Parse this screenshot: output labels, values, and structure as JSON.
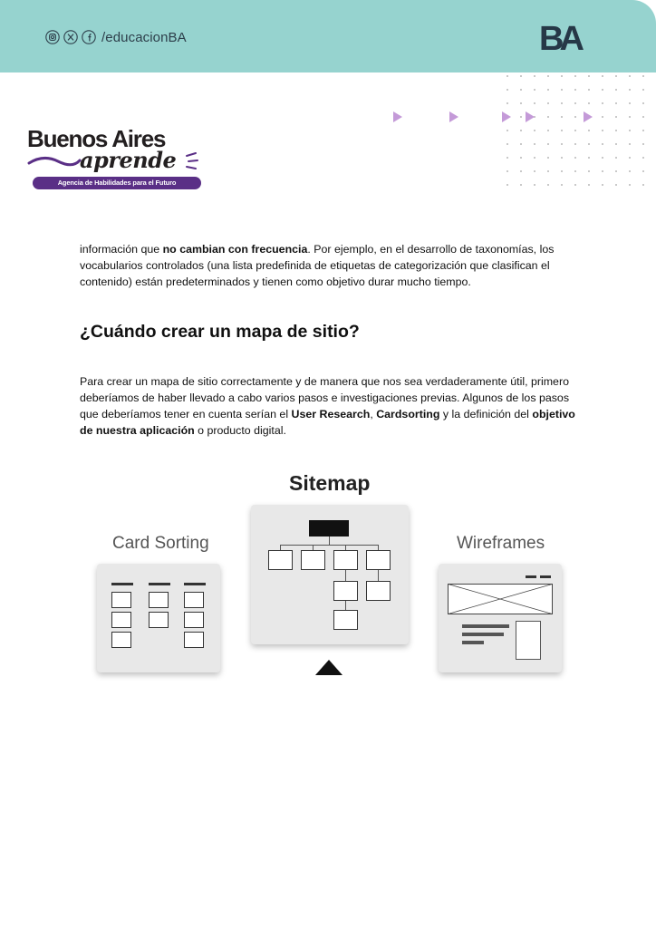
{
  "header": {
    "social_icons": [
      "instagram-icon",
      "x-icon",
      "facebook-icon"
    ],
    "handle": "/educacionBA",
    "logo_text": "BA",
    "background_color": "#96d3cf"
  },
  "brand": {
    "title": "Buenos Aires",
    "script": "aprende",
    "tagline": "Agencia de Habilidades para el Futuro",
    "accent_color": "#5a2f86"
  },
  "content": {
    "paragraph1": [
      {
        "text": "información que ",
        "bold": false
      },
      {
        "text": "no cambian con frecuencia",
        "bold": true
      },
      {
        "text": ". Por ejemplo, en el desarrollo de taxonomías, los vocabularios controlados (una lista predefinida de etiquetas de categorización que clasifican el contenido) están predeterminados y tienen como objetivo durar mucho tiempo.",
        "bold": false
      }
    ],
    "heading": "¿Cuándo crear un mapa de sitio?",
    "paragraph2": [
      {
        "text": "Para crear un mapa de sitio correctamente y de manera que nos sea verdaderamente útil, primero deberíamos de haber llevado a cabo varios pasos e investigaciones previas. Algunos de los pasos que deberíamos tener en cuenta serían el ",
        "bold": false
      },
      {
        "text": "User Research",
        "bold": true
      },
      {
        "text": ", ",
        "bold": false
      },
      {
        "text": "Cardsorting",
        "bold": true
      },
      {
        "text": " y la definición del ",
        "bold": false
      },
      {
        "text": "objetivo de nuestra aplicación",
        "bold": true
      },
      {
        "text": " o producto digital.",
        "bold": false
      }
    ]
  },
  "diagram": {
    "label_card_sorting": "Card Sorting",
    "label_sitemap": "Sitemap",
    "label_wireframes": "Wireframes"
  }
}
